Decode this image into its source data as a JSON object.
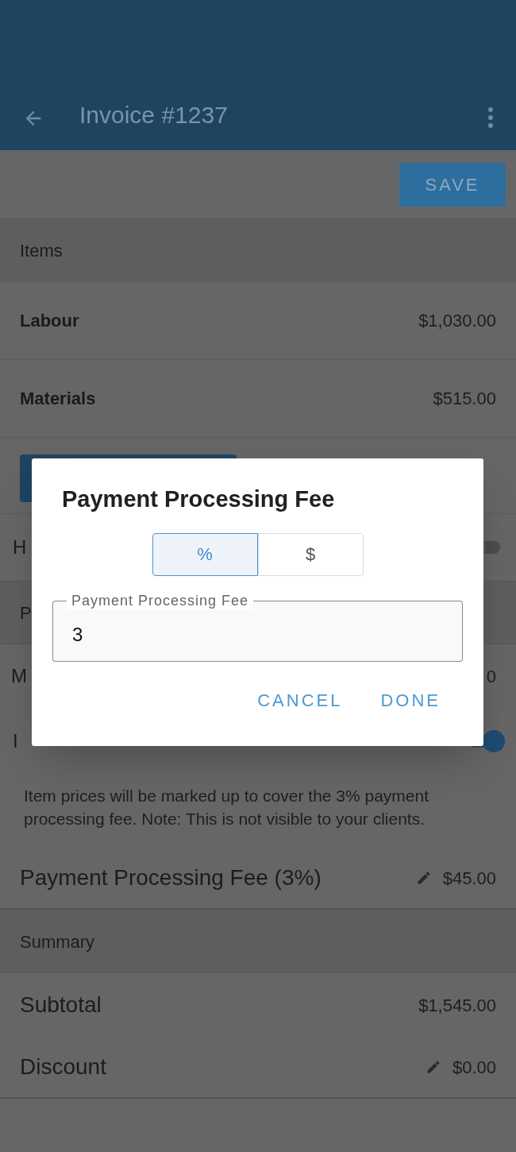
{
  "app_bar": {
    "title": "Invoice #1237"
  },
  "toolbar": {
    "save_label": "SAVE"
  },
  "rows": [
    {
      "kind": "section",
      "label": "Items"
    },
    {
      "kind": "item",
      "label": "Labour",
      "value": "$1,030.00"
    },
    {
      "kind": "item",
      "label": "Materials",
      "value": "$515.00"
    },
    {
      "kind": "button"
    },
    {
      "kind": "toggle",
      "label": "H",
      "on": false
    },
    {
      "kind": "section",
      "label": "P"
    },
    {
      "kind": "line",
      "label": "M",
      "value": "0"
    },
    {
      "kind": "toggle",
      "label": "I",
      "on": true
    },
    {
      "kind": "note",
      "text": "Item prices will be marked up to cover the 3% payment processing fee. Note: This is not visible to your clients."
    },
    {
      "kind": "editable",
      "label": "Payment Processing Fee (3%)",
      "value": "$45.00"
    },
    {
      "kind": "section",
      "label": "Summary"
    },
    {
      "kind": "line",
      "label": "Subtotal",
      "value": "$1,545.00"
    },
    {
      "kind": "editable",
      "label": "Discount",
      "value": "$0.00"
    }
  ],
  "dialog": {
    "title": "Payment Processing Fee",
    "units": [
      {
        "label": "%",
        "selected": true
      },
      {
        "label": "$",
        "selected": false
      }
    ],
    "field": {
      "label": "Payment Processing Fee",
      "value": "3"
    },
    "actions": [
      "CANCEL",
      "DONE"
    ]
  }
}
